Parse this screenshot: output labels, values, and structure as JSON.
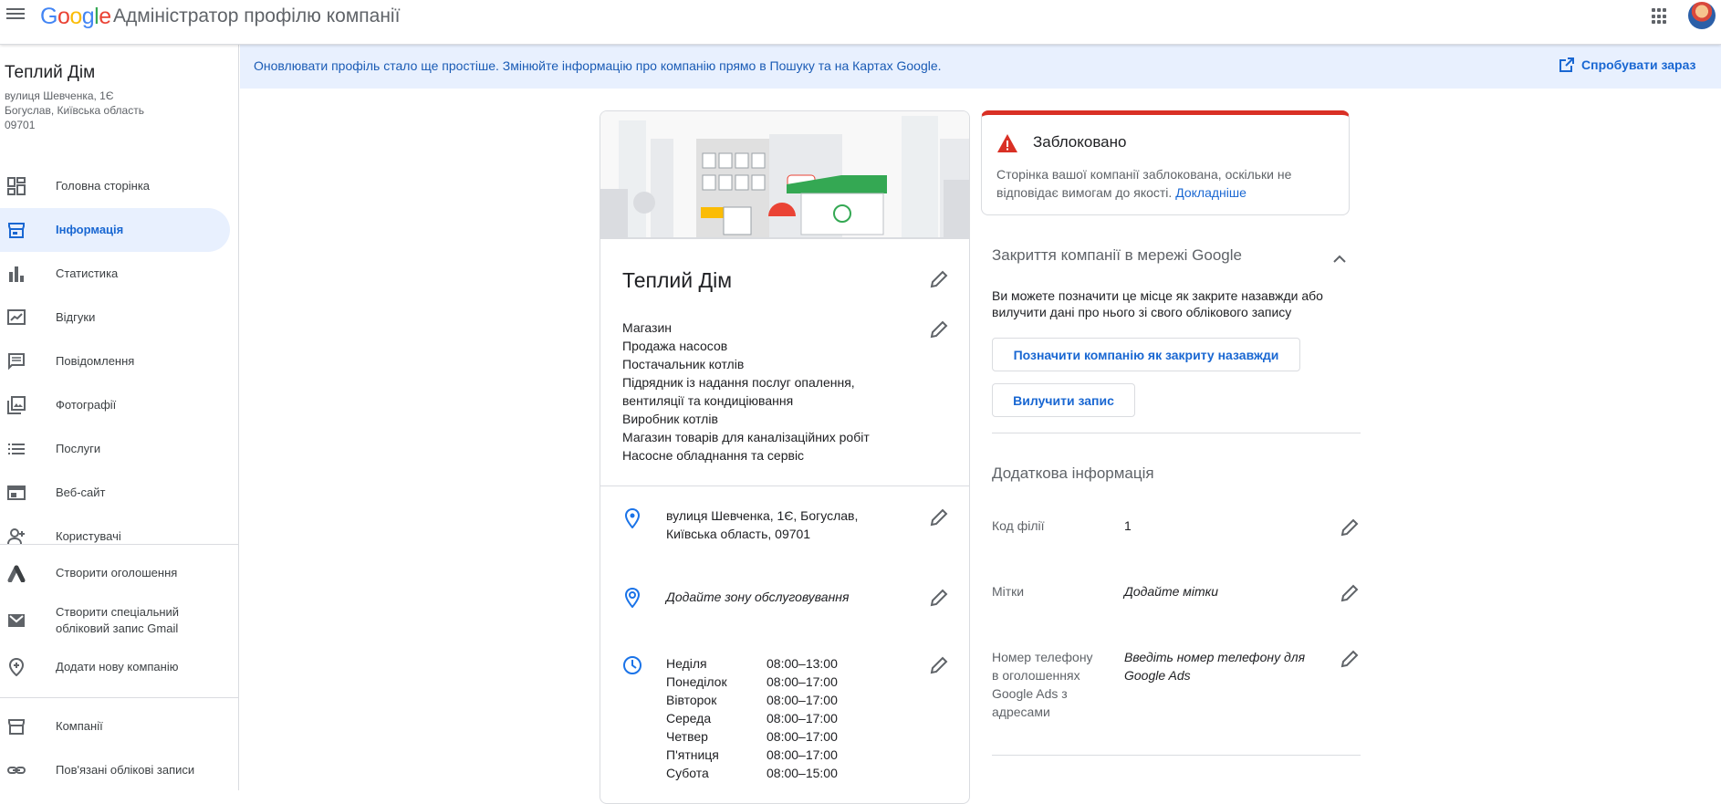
{
  "header": {
    "logo_parts": [
      "G",
      "o",
      "o",
      "g",
      "l",
      "e"
    ],
    "app_title": "Адміністратор профілю компанії",
    "apps_icon": "apps-grid-icon",
    "avatar_icon": "account-avatar"
  },
  "sidebar": {
    "business_name": "Теплий Дім",
    "address_lines": [
      "вулиця Шевченка, 1Є",
      "Богуслав, Київська область",
      "09701"
    ],
    "items": [
      {
        "label": "Головна сторінка",
        "icon": "dashboard-icon"
      },
      {
        "label": "Інформація",
        "icon": "storefront-icon",
        "active": true
      },
      {
        "label": "Статистика",
        "icon": "bar-chart-icon"
      },
      {
        "label": "Відгуки",
        "icon": "reviews-icon"
      },
      {
        "label": "Повідомлення",
        "icon": "message-icon"
      },
      {
        "label": "Фотографії",
        "icon": "photos-icon"
      },
      {
        "label": "Послуги",
        "icon": "list-icon"
      },
      {
        "label": "Веб-сайт",
        "icon": "website-icon"
      },
      {
        "label": "Користувачі",
        "icon": "add-person-icon"
      }
    ],
    "extra_items": [
      {
        "label": "Створити оголошення",
        "icon": "ads-icon"
      },
      {
        "label_lines": [
          "Створити спеціальний",
          "обліковий запис Gmail"
        ],
        "icon": "gmail-icon"
      },
      {
        "label": "Додати нову компанію",
        "icon": "add-location-icon"
      }
    ],
    "bottom_items": [
      {
        "label": "Компанії",
        "icon": "store-icon"
      },
      {
        "label": "Пов'язані облікові записи",
        "icon": "link-icon"
      }
    ]
  },
  "banner": {
    "text": "Оновлювати профіль стало ще простіше. Змінюйте інформацію про компанію прямо в Пошуку та на Картах Google.",
    "link_label": "Спробувати зараз"
  },
  "info_card": {
    "title": "Теплий Дім",
    "categories": [
      "Магазин",
      "Продажа насосов",
      "Постачальник котлів",
      "Підрядник із надання послуг опалення,",
      "вентиляції та кондиціювання",
      "Виробник котлів",
      "Магазин товарів для каналізаційних робіт",
      "Насосне обладнання та сервіс"
    ],
    "address_lines": [
      "вулиця Шевченка, 1Є, Богуслав,",
      "Київська область, 09701"
    ],
    "service_area_placeholder": "Додайте зону обслуговування",
    "hours": [
      {
        "day": "Неділя",
        "time": "08:00–13:00"
      },
      {
        "day": "Понеділок",
        "time": "08:00–17:00"
      },
      {
        "day": "Вівторок",
        "time": "08:00–17:00"
      },
      {
        "day": "Середа",
        "time": "08:00–17:00"
      },
      {
        "day": "Четвер",
        "time": "08:00–17:00"
      },
      {
        "day": "П'ятниця",
        "time": "08:00–17:00"
      },
      {
        "day": "Субота",
        "time": "08:00–15:00"
      }
    ]
  },
  "alert": {
    "title": "Заблоковано",
    "body": "Сторінка вашої компанії заблокована, оскільки не відповідає вимогам до якості.",
    "link": "Докладніше",
    "status_color": "#d93025"
  },
  "closure": {
    "title": "Закриття компанії в мережі Google",
    "text": "Ви можете позначити це місце як закрите назавжди або вилучити дані про нього зі свого облікового запису",
    "close_button": "Позначити компанію як закриту назавжди",
    "remove_button": "Вилучити запис"
  },
  "additional": {
    "title": "Додаткова інформація",
    "rows": [
      {
        "label": "Код філії",
        "value": "1",
        "italic": false
      },
      {
        "label": "Мітки",
        "value": "Додайте мітки",
        "italic": true
      },
      {
        "label": "Номер телефону в оголошеннях Google Ads з адресами",
        "value": "Введіть номер телефону для Google Ads",
        "italic": true
      }
    ]
  },
  "colors": {
    "accent": "#1967d2",
    "banner_bg": "#e8f0fe",
    "active_nav_bg": "#e8f0fe"
  }
}
